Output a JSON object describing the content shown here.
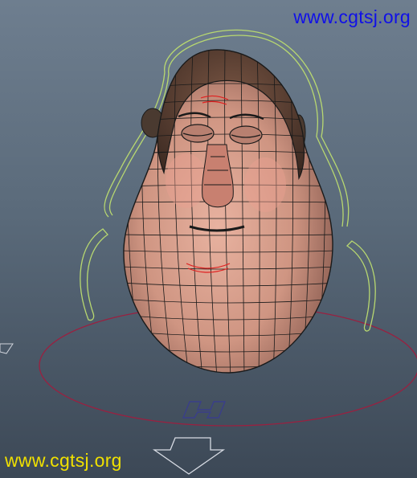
{
  "watermark_top": {
    "text": "www.cgtsj.org",
    "color": "#1010e8"
  },
  "watermark_bottom": {
    "text": "www.cgtsj.org",
    "color": "#f0e000"
  },
  "scene": {
    "subject": "wireframe cartoon head model",
    "background_top": "#6e7e8f",
    "background_bottom": "#3c4856",
    "skin_color": "#d49a88",
    "hair_color": "#5a3e30",
    "wire_color": "#1a1a1a",
    "control_curve_color": "#b8d870",
    "ground_circle_color": "#9a2040",
    "face_curve_color": "#e02020",
    "handle_icon": "h-control-icon",
    "arrow_icon": "move-arrow-icon"
  }
}
